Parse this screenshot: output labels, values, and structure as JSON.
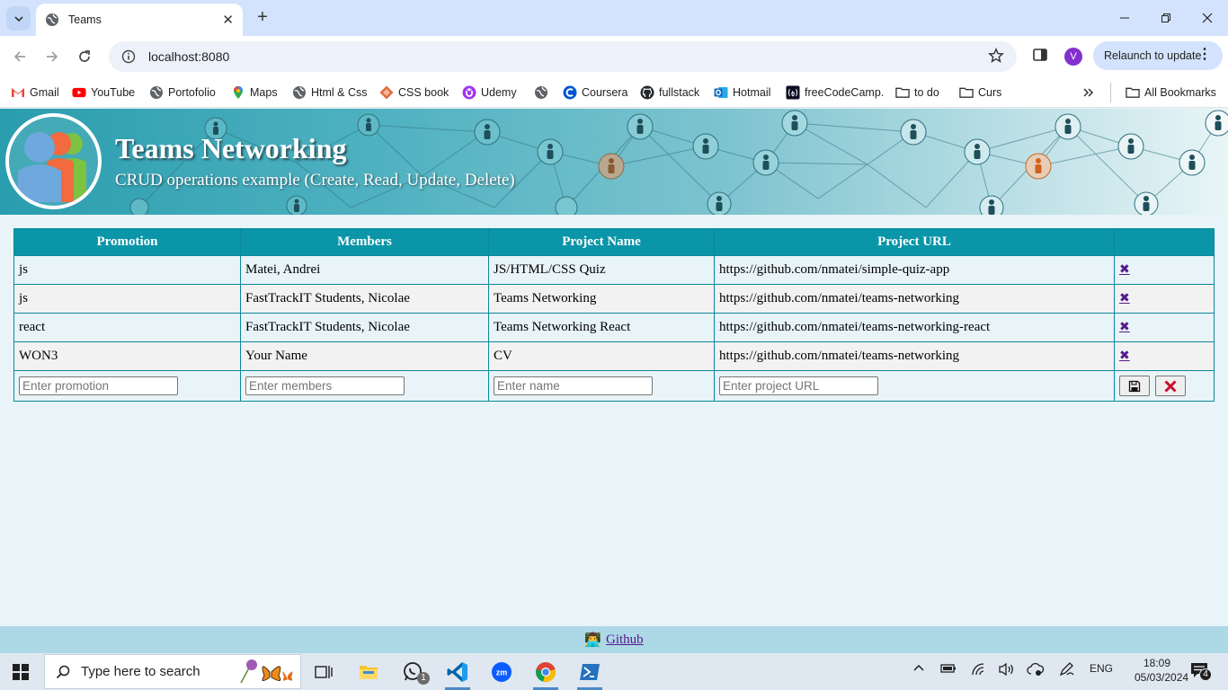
{
  "browser": {
    "tab_title": "Teams",
    "url": "localhost:8080",
    "profile_initial": "V",
    "relaunch_label": "Relaunch to update",
    "bookmarks": [
      {
        "label": "Gmail",
        "icon": "gmail-icon",
        "color": "#ea4335"
      },
      {
        "label": "YouTube",
        "icon": "youtube-icon",
        "color": "#ff0000"
      },
      {
        "label": "Portofolio",
        "icon": "globe-icon",
        "color": "#5f6368"
      },
      {
        "label": "Maps",
        "icon": "maps-icon",
        "color": "#34a853"
      },
      {
        "label": "Html & Css",
        "icon": "globe-icon",
        "color": "#5f6368"
      },
      {
        "label": "CSS book",
        "icon": "css-book-icon",
        "color": "#e06c3c"
      },
      {
        "label": "Udemy",
        "icon": "udemy-icon",
        "color": "#a435f0"
      },
      {
        "label": "",
        "icon": "globe-icon",
        "color": "#5f6368"
      },
      {
        "label": "Coursera",
        "icon": "coursera-icon",
        "color": "#0056d2"
      },
      {
        "label": "fullstack",
        "icon": "github-icon",
        "color": "#24292f"
      },
      {
        "label": "Hotmail",
        "icon": "outlook-icon",
        "color": "#0f6cbd"
      },
      {
        "label": "freeCodeCamp.",
        "icon": "freecodecamp-icon",
        "color": "#0a0a23"
      },
      {
        "label": "to do",
        "icon": "folder-icon",
        "color": "#5f6368"
      },
      {
        "label": "Curs",
        "icon": "folder-icon",
        "color": "#5f6368"
      }
    ],
    "all_bookmarks_label": "All Bookmarks"
  },
  "page": {
    "title": "Teams Networking",
    "subtitle": "CRUD operations example (Create, Read, Update, Delete)",
    "table": {
      "headers": [
        "Promotion",
        "Members",
        "Project Name",
        "Project URL",
        ""
      ],
      "rows": [
        {
          "promotion": "js",
          "members": "Matei, Andrei",
          "name": "JS/HTML/CSS Quiz",
          "url": "https://github.com/nmatei/simple-quiz-app",
          "delete": "✖"
        },
        {
          "promotion": "js",
          "members": "FastTrackIT Students, Nicolae",
          "name": "Teams Networking",
          "url": "https://github.com/nmatei/teams-networking",
          "delete": "✖"
        },
        {
          "promotion": "react",
          "members": "FastTrackIT Students, Nicolae",
          "name": "Teams Networking React",
          "url": "https://github.com/nmatei/teams-networking-react",
          "delete": "✖"
        },
        {
          "promotion": "WON3",
          "members": "Your Name",
          "name": "CV",
          "url": "https://github.com/nmatei/teams-networking",
          "delete": "✖"
        }
      ],
      "form": {
        "promotion_placeholder": "Enter promotion",
        "members_placeholder": "Enter members",
        "name_placeholder": "Enter name",
        "url_placeholder": "Enter project URL"
      }
    },
    "footer": {
      "emoji": "👨‍💻",
      "link_label": "Github"
    }
  },
  "taskbar": {
    "search_placeholder": "Type here to search",
    "whatsapp_badge": "1",
    "language": "ENG",
    "time": "18:09",
    "date": "05/03/2024",
    "notifications_count": "4"
  }
}
